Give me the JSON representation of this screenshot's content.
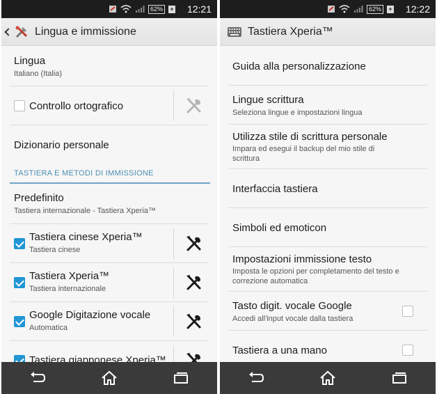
{
  "left": {
    "status_time": "12:21",
    "battery": "62%",
    "title": "Lingua e immissione",
    "lingua": {
      "title": "Lingua",
      "subtitle": "Italiano (Italia)"
    },
    "controllo": {
      "title": "Controllo ortografico",
      "checked": false
    },
    "dizionario": {
      "title": "Dizionario personale"
    },
    "section": "TASTIERA E METODI DI IMMISSIONE",
    "predefinito": {
      "title": "Predefinito",
      "subtitle": "Tastiera internazionale - Tastiera Xperia™"
    },
    "keyboards": [
      {
        "title": "Tastiera cinese Xperia™",
        "subtitle": "Tastiera cinese",
        "checked": true
      },
      {
        "title": "Tastiera Xperia™",
        "subtitle": "Tastiera internazionale",
        "checked": true
      },
      {
        "title": "Google Digitazione vocale",
        "subtitle": "Automatica",
        "checked": true
      },
      {
        "title": "Tastiera giapponese Xperia™",
        "subtitle": "",
        "checked": true
      }
    ]
  },
  "right": {
    "status_time": "12:22",
    "battery": "62%",
    "title": "Tastiera Xperia™",
    "items": [
      {
        "title": "Guida alla personalizzazione",
        "subtitle": ""
      },
      {
        "title": "Lingue scrittura",
        "subtitle": "Seleziona lingue e impostazioni lingua"
      },
      {
        "title": "Utilizza stile di scrittura personale",
        "subtitle": "Impara ed esegui il backup del mio stile di scrittura"
      },
      {
        "title": "Interfaccia tastiera",
        "subtitle": ""
      },
      {
        "title": "Simboli ed emoticon",
        "subtitle": ""
      },
      {
        "title": "Impostazioni immissione testo",
        "subtitle": "Imposta le opzioni per completamento del testo e correzione automatica"
      },
      {
        "title": "Tasto digit. vocale Google",
        "subtitle": "Accedi all'input vocale dalla tastiera",
        "checked": false
      },
      {
        "title": "Tastiera a una mano",
        "subtitle": "",
        "checked": false
      }
    ]
  },
  "colors": {
    "accent": "#2196d3",
    "section": "#4a8fb5",
    "navbar": "#3a3a3a",
    "statusbar": "#1d1d1d"
  },
  "icons": [
    "back-icon",
    "home-icon",
    "recent-apps-icon",
    "wrench-screwdriver-icon",
    "keyboard-icon",
    "wifi-icon",
    "signal-icon",
    "battery-icon"
  ]
}
